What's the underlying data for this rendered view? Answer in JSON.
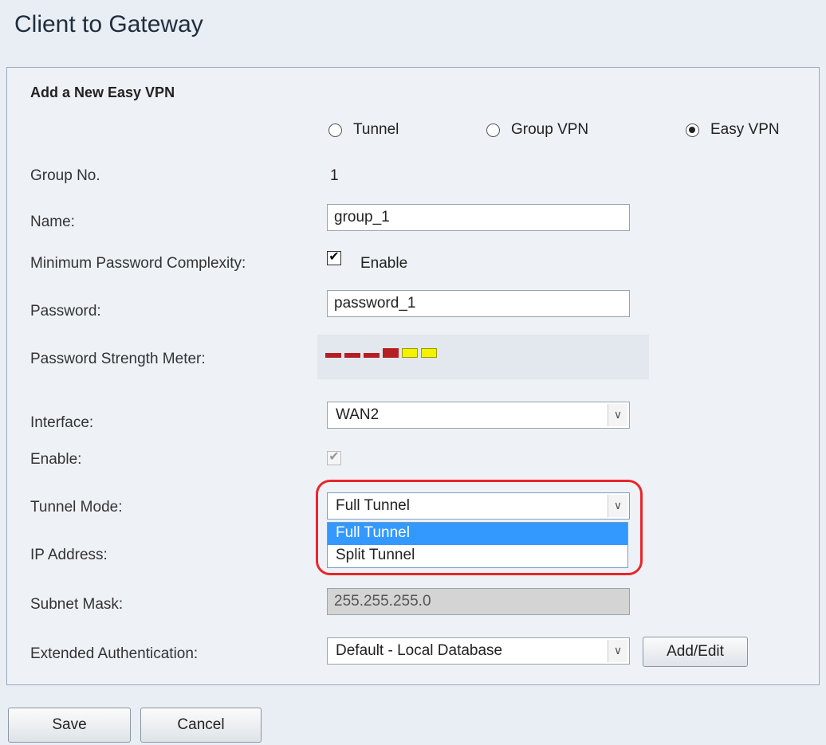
{
  "page": {
    "title": "Client to Gateway"
  },
  "section": {
    "title": "Add a New Easy VPN"
  },
  "vpn_type": {
    "options": [
      "Tunnel",
      "Group VPN",
      "Easy VPN"
    ],
    "selected": "Easy VPN"
  },
  "form": {
    "group_no_label": "Group No.",
    "group_no_value": "1",
    "name_label": "Name:",
    "name_value": "group_1",
    "min_pw_label": "Minimum Password Complexity:",
    "min_pw_checked": true,
    "min_pw_enable_label": "Enable",
    "password_label": "Password:",
    "password_value": "password_1",
    "strength_label": "Password Strength Meter:",
    "strength_meter": {
      "segments": 6,
      "red_segments": 4,
      "yellow_segments": 2
    },
    "interface_label": "Interface:",
    "interface_value": "WAN2",
    "enable_label": "Enable:",
    "enable_checked": true,
    "tunnel_mode_label": "Tunnel Mode:",
    "tunnel_mode_value": "Full Tunnel",
    "tunnel_mode_options": [
      "Full Tunnel",
      "Split Tunnel"
    ],
    "ip_address_label": "IP Address:",
    "subnet_mask_label": "Subnet Mask:",
    "subnet_mask_value": "255.255.255.0",
    "ext_auth_label": "Extended Authentication:",
    "ext_auth_value": "Default - Local Database",
    "add_edit_label": "Add/Edit"
  },
  "buttons": {
    "save_label": "Save",
    "cancel_label": "Cancel"
  },
  "colors": {
    "highlight_ring": "#e8262a",
    "dropdown_selected": "#3399ff",
    "meter_red": "#b51f24",
    "meter_yellow": "#f3f300"
  }
}
